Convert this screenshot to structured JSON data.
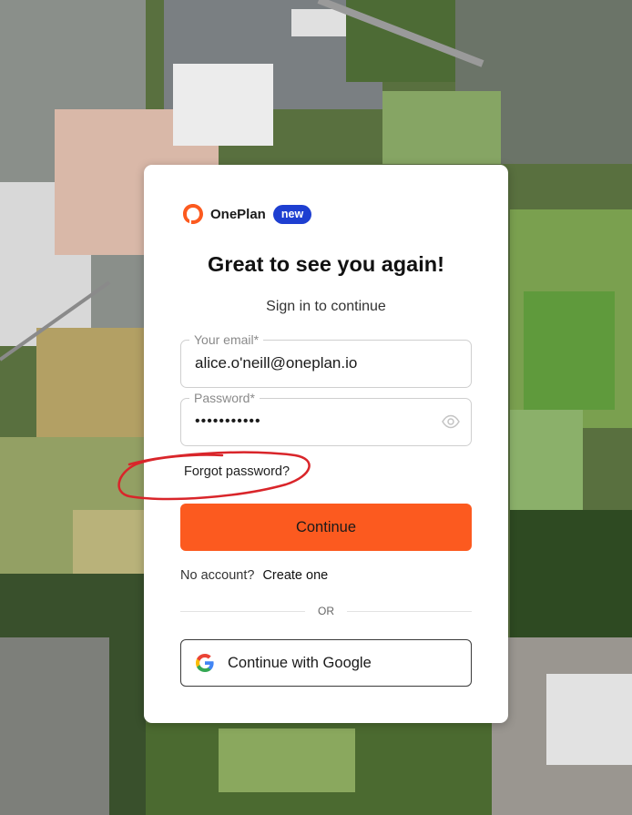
{
  "brand": {
    "name": "OnePlan",
    "badge": "new",
    "accent": "#fc5a1f",
    "badge_color": "#1e3fd1"
  },
  "heading": "Great to see you again!",
  "subheading": "Sign in to continue",
  "email": {
    "label": "Your email*",
    "value": "alice.o'neill@oneplan.io"
  },
  "password": {
    "label": "Password*",
    "value": "•••••••••••",
    "toggle_icon": "eye-icon"
  },
  "forgot_password": "Forgot password?",
  "continue_label": "Continue",
  "signup": {
    "prompt": "No account?",
    "link": "Create one"
  },
  "divider_text": "OR",
  "google_button": {
    "label": "Continue with Google",
    "icon": "google-icon"
  }
}
